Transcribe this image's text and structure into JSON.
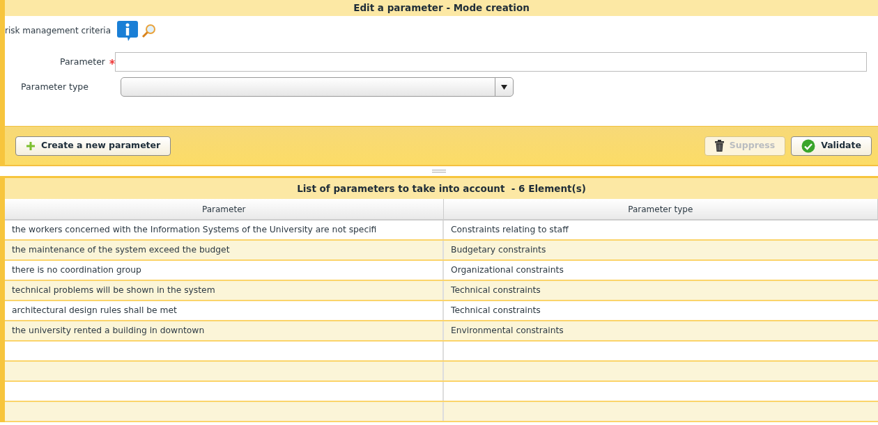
{
  "editor": {
    "title": "Edit a parameter - Mode creation",
    "context": "risk management criteria",
    "fields": [
      {
        "kind": "text",
        "label": "Parameter",
        "required": true
      },
      {
        "kind": "select",
        "label": "Parameter type",
        "required": false
      }
    ],
    "buttons": [
      {
        "kind": "create",
        "label": "Create a new parameter",
        "disabled": false
      },
      {
        "kind": "suppress",
        "label": "Suppress",
        "disabled": true
      },
      {
        "kind": "validate",
        "label": "Validate",
        "disabled": false
      }
    ]
  },
  "list": {
    "title": "List of parameters to take into account  - 6 Element(s)",
    "columns": [
      "Parameter",
      "Parameter type"
    ],
    "rows": [
      [
        "the workers concerned with the Information Systems of the University are not specifi",
        "Constraints relating to staff"
      ],
      [
        "the maintenance of the system exceed the budget",
        "Budgetary constraints"
      ],
      [
        "there is no coordination group",
        "Organizational constraints"
      ],
      [
        "technical problems will be shown in the system",
        "Technical constraints"
      ],
      [
        "architectural design rules shall be met",
        "Technical constraints"
      ],
      [
        "the university rented a building in downtown",
        "Environmental constraints"
      ]
    ]
  }
}
